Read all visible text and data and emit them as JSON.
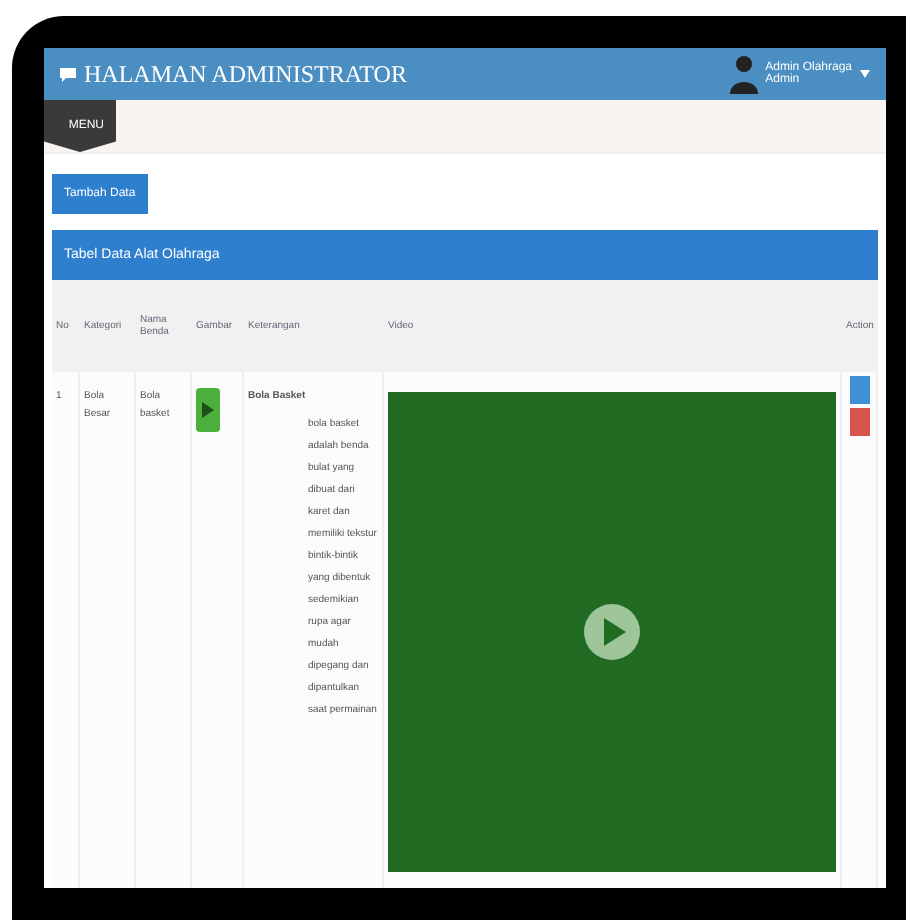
{
  "header": {
    "title": "HALAMAN ADMINISTRATOR",
    "user_name": "Admin Olahraga",
    "user_role": "Admin"
  },
  "menu_tab": "MENU",
  "add_button": "Tambah Data",
  "panel_title": "Tabel Data Alat Olahraga",
  "table": {
    "columns": [
      "No",
      "Kategori",
      "Nama Benda",
      "Gambar",
      "Keterangan",
      "Video",
      "Action"
    ],
    "rows": [
      {
        "no": "1",
        "category": "Bola Besar",
        "name": "Bola basket",
        "desc_title": "Bola Basket",
        "desc": "bola basket adalah benda bulat yang dibuat dari karet dan memiliki tekstur bintik-bintik yang dibentuk sedemikian rupa agar mudah dipegang dan dipantulkan saat permainan"
      }
    ]
  }
}
